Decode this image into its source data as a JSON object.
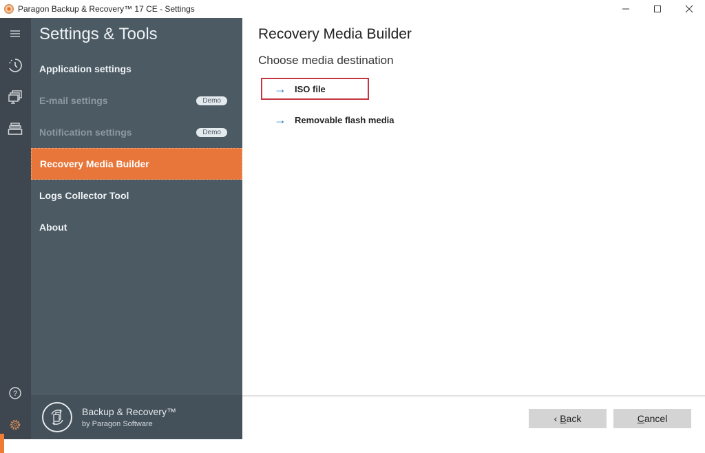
{
  "window": {
    "title": "Paragon Backup & Recovery™ 17 CE - Settings",
    "controls": {
      "minimize": "—",
      "maximize": "☐",
      "close": "✕"
    }
  },
  "rail": {
    "icons": [
      "menu-icon",
      "history-icon",
      "monitors-icon",
      "drive-icon",
      "help-icon",
      "settings-icon"
    ],
    "accent": "#f07b32"
  },
  "sidebar": {
    "title": "Settings & Tools",
    "items": [
      {
        "label": "Application settings",
        "state": "normal"
      },
      {
        "label": "E-mail settings",
        "state": "disabled",
        "badge": "Demo"
      },
      {
        "label": "Notification settings",
        "state": "disabled",
        "badge": "Demo"
      },
      {
        "label": "Recovery Media Builder",
        "state": "active"
      },
      {
        "label": "Logs Collector Tool",
        "state": "normal"
      },
      {
        "label": "About",
        "state": "normal"
      }
    ],
    "footer": {
      "product": "Backup & Recovery™",
      "vendor": "by Paragon Software"
    }
  },
  "main": {
    "title": "Recovery Media Builder",
    "subtitle": "Choose media destination",
    "options": [
      {
        "label": "ISO file",
        "highlighted": true
      },
      {
        "label": "Removable flash media",
        "highlighted": false
      }
    ],
    "buttons": {
      "back_prefix": "‹ ",
      "back_mnemonic": "B",
      "back_rest": "ack",
      "cancel_mnemonic": "C",
      "cancel_rest": "ancel"
    }
  },
  "colors": {
    "active_item": "#e8763a",
    "sidebar_bg": "#4c5a64",
    "rail_bg": "#3e474f",
    "highlight_border": "#c33540",
    "arrow": "#2f7cc0"
  }
}
